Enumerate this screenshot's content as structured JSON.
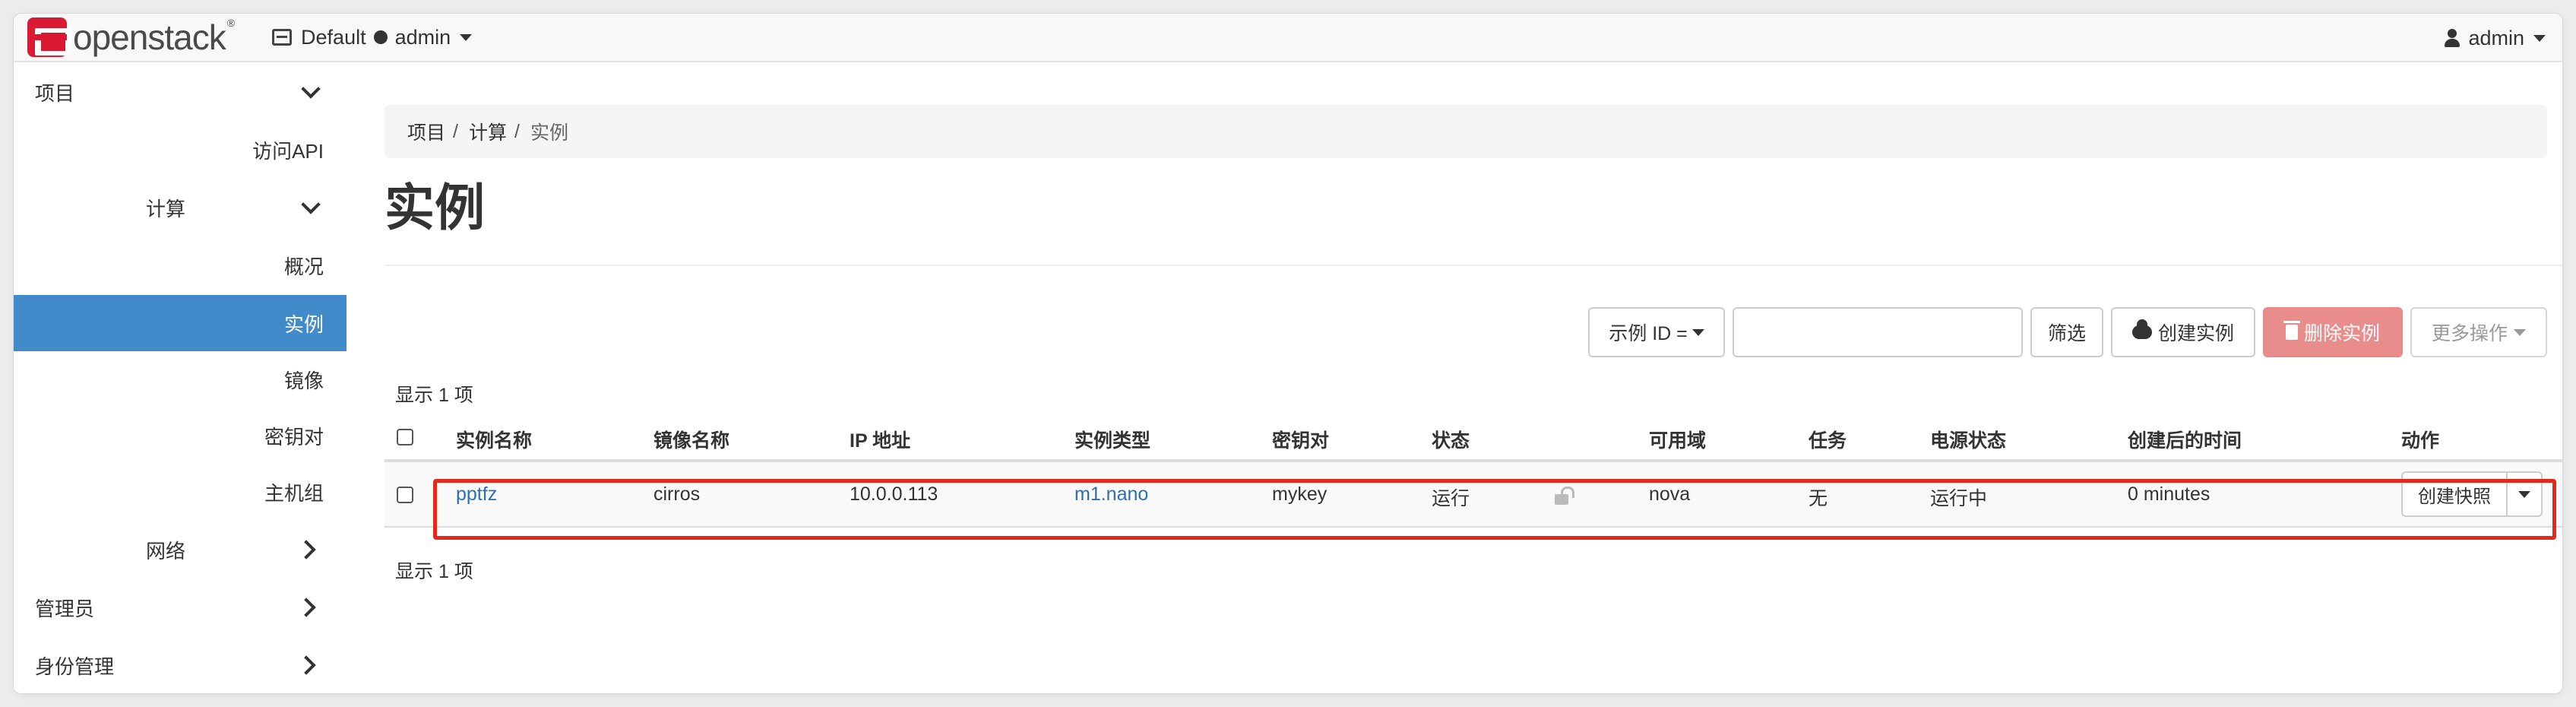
{
  "app": {
    "logo_text": "openstack",
    "logo_mark": "®"
  },
  "navbar": {
    "domain": "Default",
    "project": "admin",
    "user": "admin"
  },
  "sidebar": {
    "items": [
      {
        "label": "项目",
        "chevron": "down"
      },
      {
        "label": "访问API"
      },
      {
        "label": "计算",
        "chevron": "down"
      },
      {
        "label": "概况"
      },
      {
        "label": "实例",
        "active": true
      },
      {
        "label": "镜像"
      },
      {
        "label": "密钥对"
      },
      {
        "label": "主机组"
      },
      {
        "label": "网络",
        "chevron": "right"
      },
      {
        "label": "管理员",
        "chevron": "right"
      },
      {
        "label": "身份管理",
        "chevron": "right"
      }
    ]
  },
  "breadcrumb": [
    "项目",
    "计算",
    "实例"
  ],
  "page_title": "实例",
  "toolbar": {
    "filter_field": "示例 ID =",
    "filter_value": "",
    "filter_button": "筛选",
    "create_button": "创建实例",
    "delete_button": "删除实例",
    "more_button": "更多操作"
  },
  "count_text": "显示 1 项",
  "table": {
    "headers": [
      "实例名称",
      "镜像名称",
      "IP 地址",
      "实例类型",
      "密钥对",
      "状态",
      "可用域",
      "任务",
      "电源状态",
      "创建后的时间",
      "动作"
    ],
    "rows": [
      {
        "name": "pptfz",
        "image": "cirros",
        "ip": "10.0.0.113",
        "flavor": "m1.nano",
        "keypair": "mykey",
        "status": "运行",
        "zone": "nova",
        "task": "无",
        "power": "运行中",
        "age": "0 minutes",
        "action": "创建快照"
      }
    ]
  },
  "colors": {
    "active_nav": "#428bca",
    "link": "#2a6fb5",
    "danger": "#e98d8c",
    "highlight": "#e5281c"
  }
}
